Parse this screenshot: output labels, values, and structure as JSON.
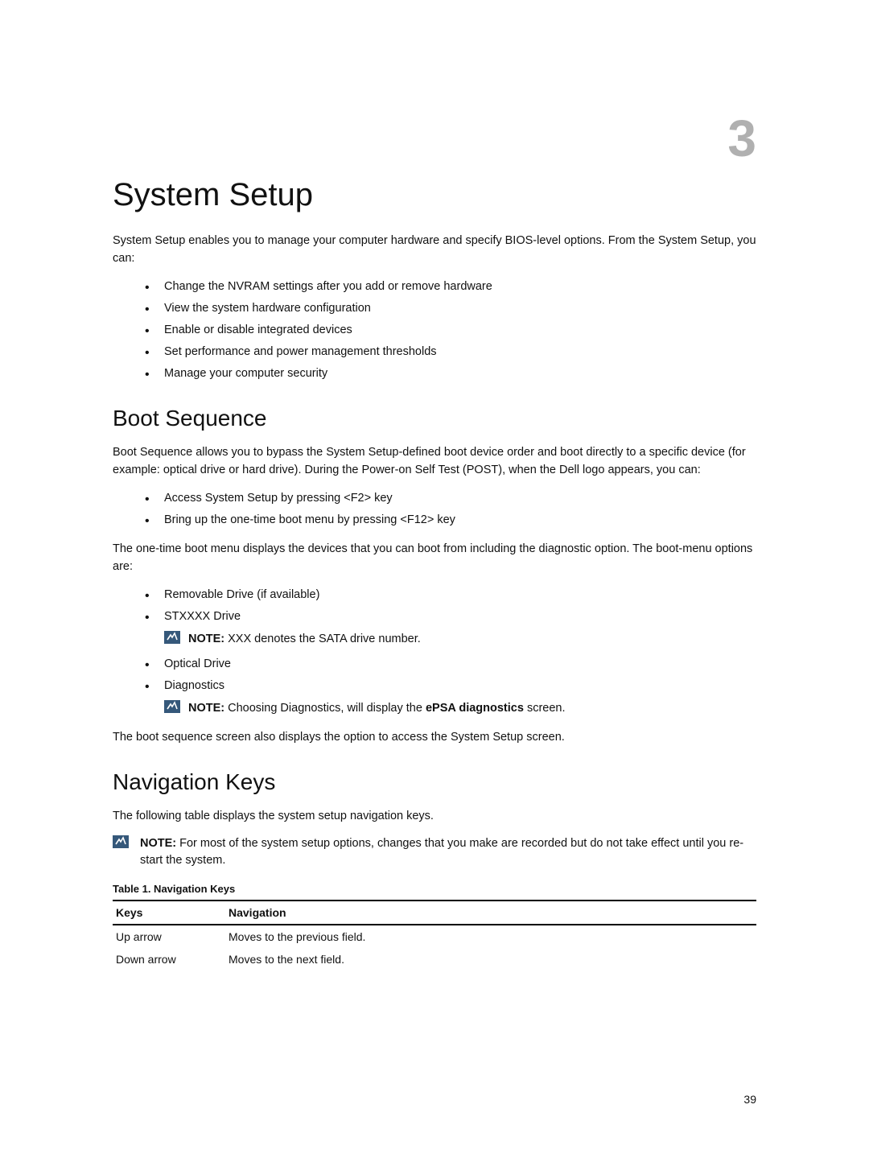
{
  "chapter_number": "3",
  "page_number": "39",
  "h1": "System Setup",
  "intro": "System Setup enables you to manage your computer hardware and specify BIOS-level options. From the System Setup, you can:",
  "intro_bullets": [
    "Change the NVRAM settings after you add or remove hardware",
    "View the system hardware configuration",
    "Enable or disable integrated devices",
    "Set performance and power management thresholds",
    "Manage your computer security"
  ],
  "boot": {
    "heading": "Boot Sequence",
    "p1": "Boot Sequence allows you to bypass the System Setup‑defined boot device order and boot directly to a specific device (for example: optical drive or hard drive). During the Power-on Self Test (POST), when the Dell logo appears, you can:",
    "bullets1": [
      "Access System Setup by pressing <F2> key",
      "Bring up the one-time boot menu by pressing <F12> key"
    ],
    "p2": "The one-time boot menu displays the devices that you can boot from including the diagnostic option. The boot-menu options are:",
    "bullet_a": "Removable Drive (if available)",
    "bullet_b": "STXXXX Drive",
    "note1_label": "NOTE: ",
    "note1_text": "XXX denotes the SATA drive number.",
    "bullet_c": "Optical Drive",
    "bullet_d": "Diagnostics",
    "note2_label": "NOTE: ",
    "note2_pre": "Choosing Diagnostics, will display the ",
    "note2_strong": "ePSA diagnostics",
    "note2_post": " screen.",
    "p3": "The boot sequence screen also displays the option to access the System Setup screen."
  },
  "nav": {
    "heading": "Navigation Keys",
    "p1": "The following table displays the system setup navigation keys.",
    "note_label": "NOTE: ",
    "note_text": "For most of the system setup options, changes that you make are recorded but do not take effect until you re-start the system.",
    "table_caption": "Table 1. Navigation Keys",
    "col_keys": "Keys",
    "col_nav": "Navigation",
    "rows": [
      {
        "key": "Up arrow",
        "nav": "Moves to the previous field."
      },
      {
        "key": "Down arrow",
        "nav": "Moves to the next field."
      }
    ]
  },
  "chart_data": {
    "type": "table",
    "title": "Table 1. Navigation Keys",
    "columns": [
      "Keys",
      "Navigation"
    ],
    "rows": [
      [
        "Up arrow",
        "Moves to the previous field."
      ],
      [
        "Down arrow",
        "Moves to the next field."
      ]
    ]
  }
}
